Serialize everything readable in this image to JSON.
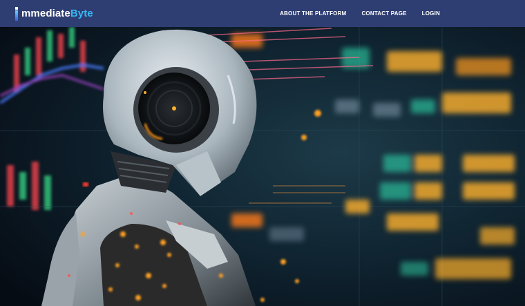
{
  "brand": {
    "logo_prefix": "mmediate",
    "logo_suffix": "Byte",
    "accent_color": "#38b7f2",
    "header_color": "#2f3e72"
  },
  "nav": {
    "items": [
      {
        "label": "ABOUT THE PLATFORM"
      },
      {
        "label": "CONTACT PAGE"
      },
      {
        "label": "LOGIN"
      }
    ]
  },
  "hero": {
    "image": "robot-in-front-of-trading-screens"
  }
}
